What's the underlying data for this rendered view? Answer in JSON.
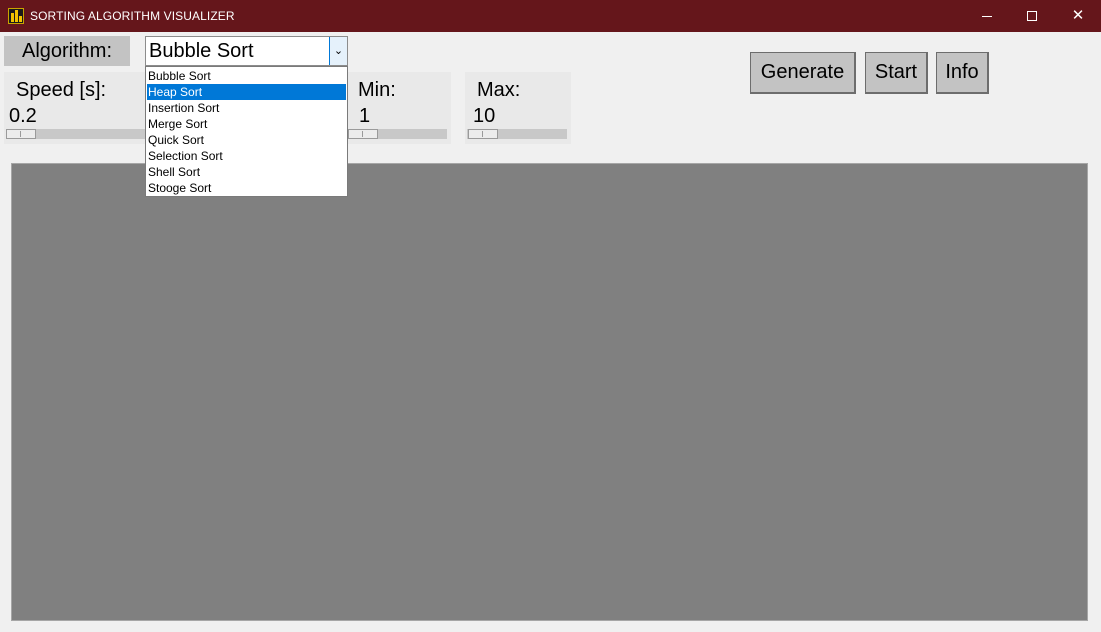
{
  "window": {
    "title": "SORTING ALGORITHM VISUALIZER",
    "controls": {
      "minimize": "–",
      "maximize": "□",
      "close": "✕"
    }
  },
  "algorithm": {
    "label": "Algorithm:",
    "selected": "Bubble Sort",
    "dropdown_arrow": "⌄",
    "options": [
      "Bubble Sort",
      "Heap Sort",
      "Insertion Sort",
      "Merge Sort",
      "Quick Sort",
      "Selection Sort",
      "Shell Sort",
      "Stooge Sort"
    ],
    "highlighted_option": "Heap Sort"
  },
  "speed": {
    "label": "Speed [s]:",
    "value": "0.2",
    "slider_fraction": 0.0
  },
  "min": {
    "label": "Min:",
    "value": "1",
    "slider_fraction": 0.0
  },
  "max": {
    "label": "Max:",
    "value": "10",
    "slider_fraction": 0.0
  },
  "buttons": {
    "generate": "Generate",
    "start": "Start",
    "info": "Info"
  },
  "colors": {
    "titlebar": "#65161b",
    "label_bg": "#c3c3c3",
    "canvas_bg": "#808080",
    "selection": "#0078d7"
  }
}
